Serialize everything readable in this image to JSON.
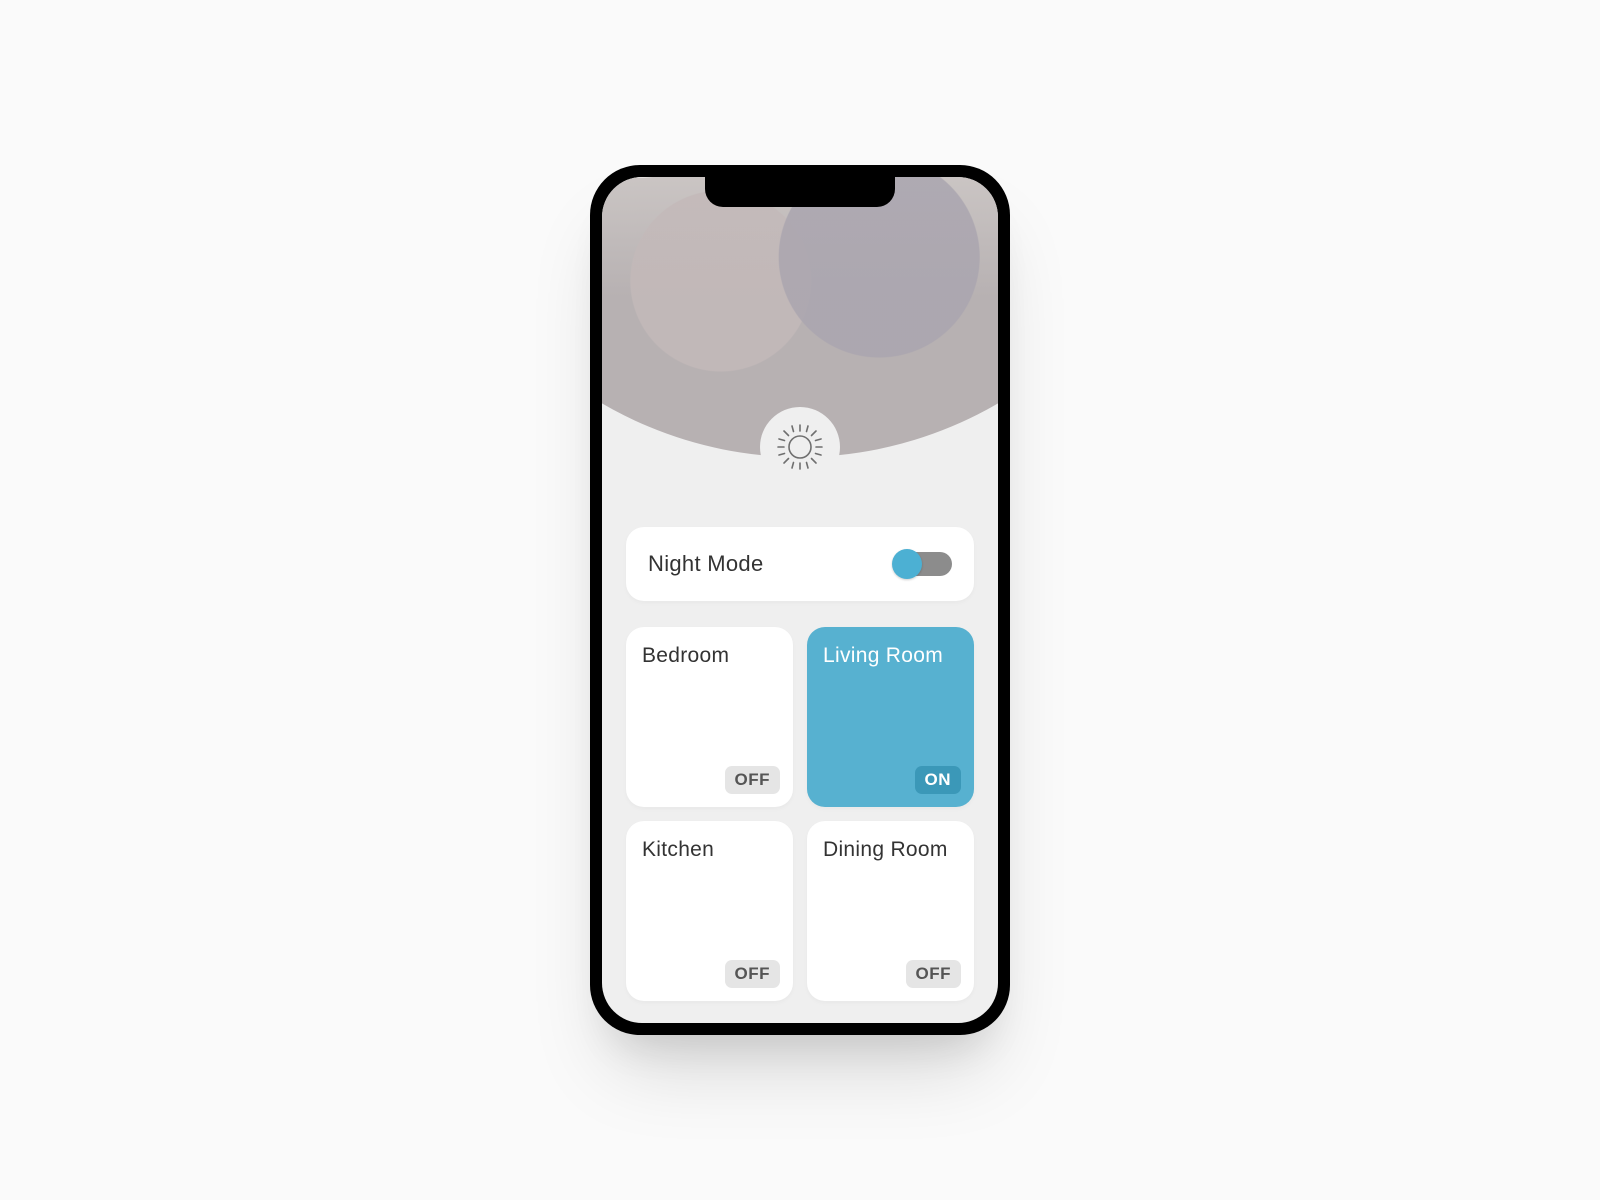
{
  "colors": {
    "accent": "#4CB0D3",
    "tileActive": "#57B1D0",
    "tileActiveBadge": "#3B98B8",
    "pageBg": "#fafafa",
    "screenBg": "#efefef"
  },
  "header": {
    "icon": "sun-icon"
  },
  "mode": {
    "label": "Night Mode",
    "on": false
  },
  "rooms": [
    {
      "name": "Bedroom",
      "state": "OFF",
      "active": false
    },
    {
      "name": "Living Room",
      "state": "ON",
      "active": true
    },
    {
      "name": "Kitchen",
      "state": "OFF",
      "active": false
    },
    {
      "name": "Dining Room",
      "state": "OFF",
      "active": false
    }
  ]
}
